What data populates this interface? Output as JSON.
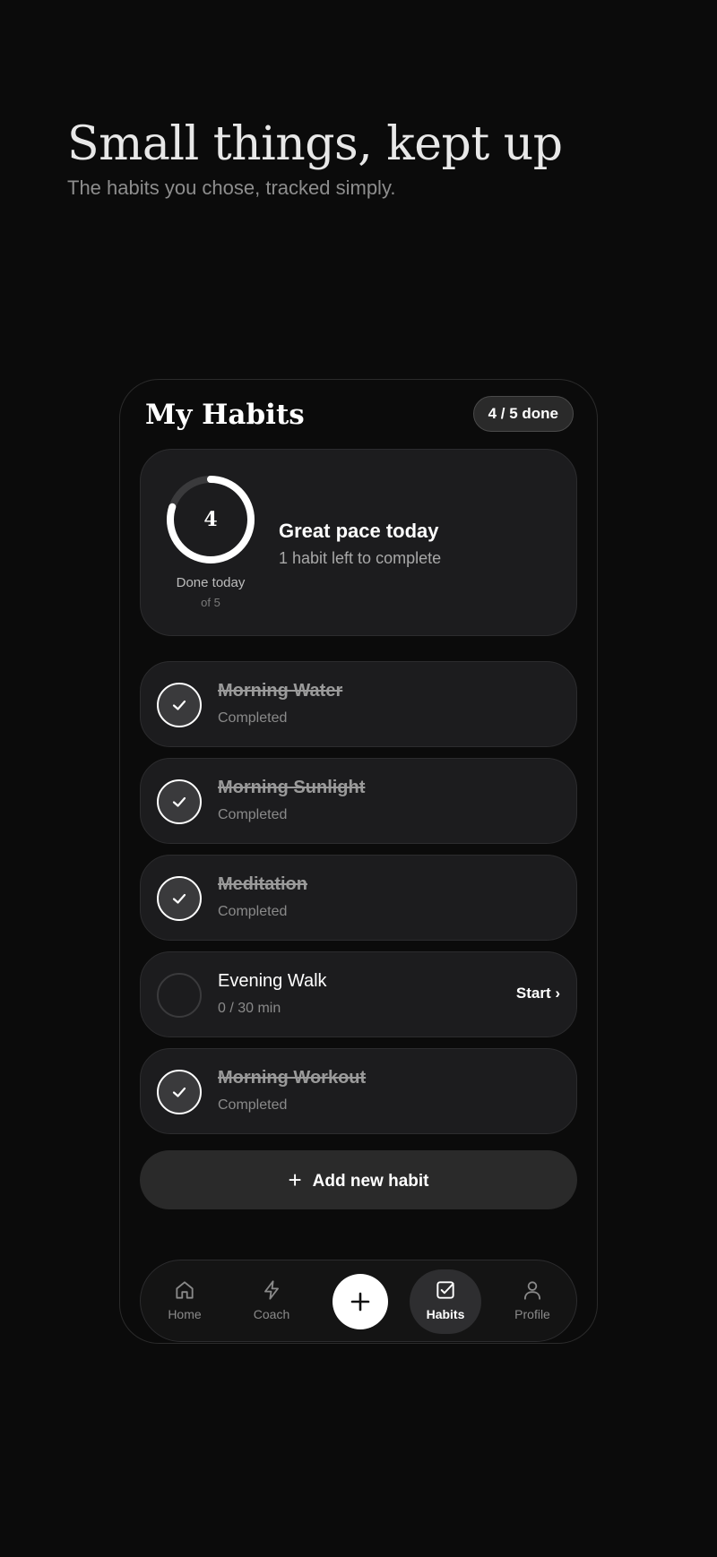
{
  "hero": {
    "title": "Small things, kept up",
    "subtitle": "The habits you chose, tracked simply."
  },
  "header": {
    "title": "My Habits",
    "badge": "4 / 5 done"
  },
  "summary": {
    "done_count": "4",
    "done_label": "Done today",
    "total_label": "of 5",
    "progress_fraction": 0.8,
    "title": "Great pace today",
    "subtitle": "1 habit left to complete"
  },
  "habits": [
    {
      "name": "Morning Water",
      "status": "Completed",
      "done": true
    },
    {
      "name": "Morning Sunlight",
      "status": "Completed",
      "done": true
    },
    {
      "name": "Meditation",
      "status": "Completed",
      "done": true
    },
    {
      "name": "Evening Walk",
      "status": "0 / 30 min",
      "done": false,
      "action": "Start ›"
    },
    {
      "name": "Morning Workout",
      "status": "Completed",
      "done": true
    }
  ],
  "add_button": {
    "icon": "plus-icon",
    "label": "Add new habit"
  },
  "tabbar": {
    "items": [
      {
        "label": "Home",
        "icon": "home-icon"
      },
      {
        "label": "Coach",
        "icon": "lightning-icon"
      },
      {
        "label": "Habits",
        "icon": "checkbox-icon",
        "active": true
      },
      {
        "label": "Profile",
        "icon": "person-icon"
      }
    ],
    "fab_icon": "plus-icon"
  },
  "colors": {
    "background": "#0b0b0b",
    "card": "#1c1c1e",
    "accent": "#ffffff",
    "muted_text": "#8a8a8a"
  }
}
